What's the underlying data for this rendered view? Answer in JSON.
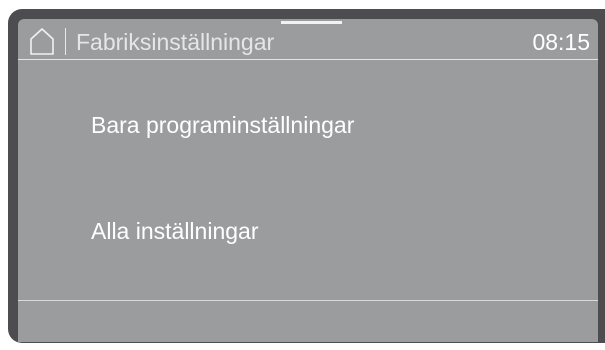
{
  "header": {
    "icon": "home-icon",
    "title": "Fabriksinställningar",
    "clock": "08:15"
  },
  "menu": {
    "items": [
      {
        "label": "Bara programinställningar"
      },
      {
        "label": "Alla inställningar"
      }
    ]
  },
  "colors": {
    "bezel": "#4d4d4f",
    "screen": "#9b9c9e",
    "text": "#ffffff"
  }
}
